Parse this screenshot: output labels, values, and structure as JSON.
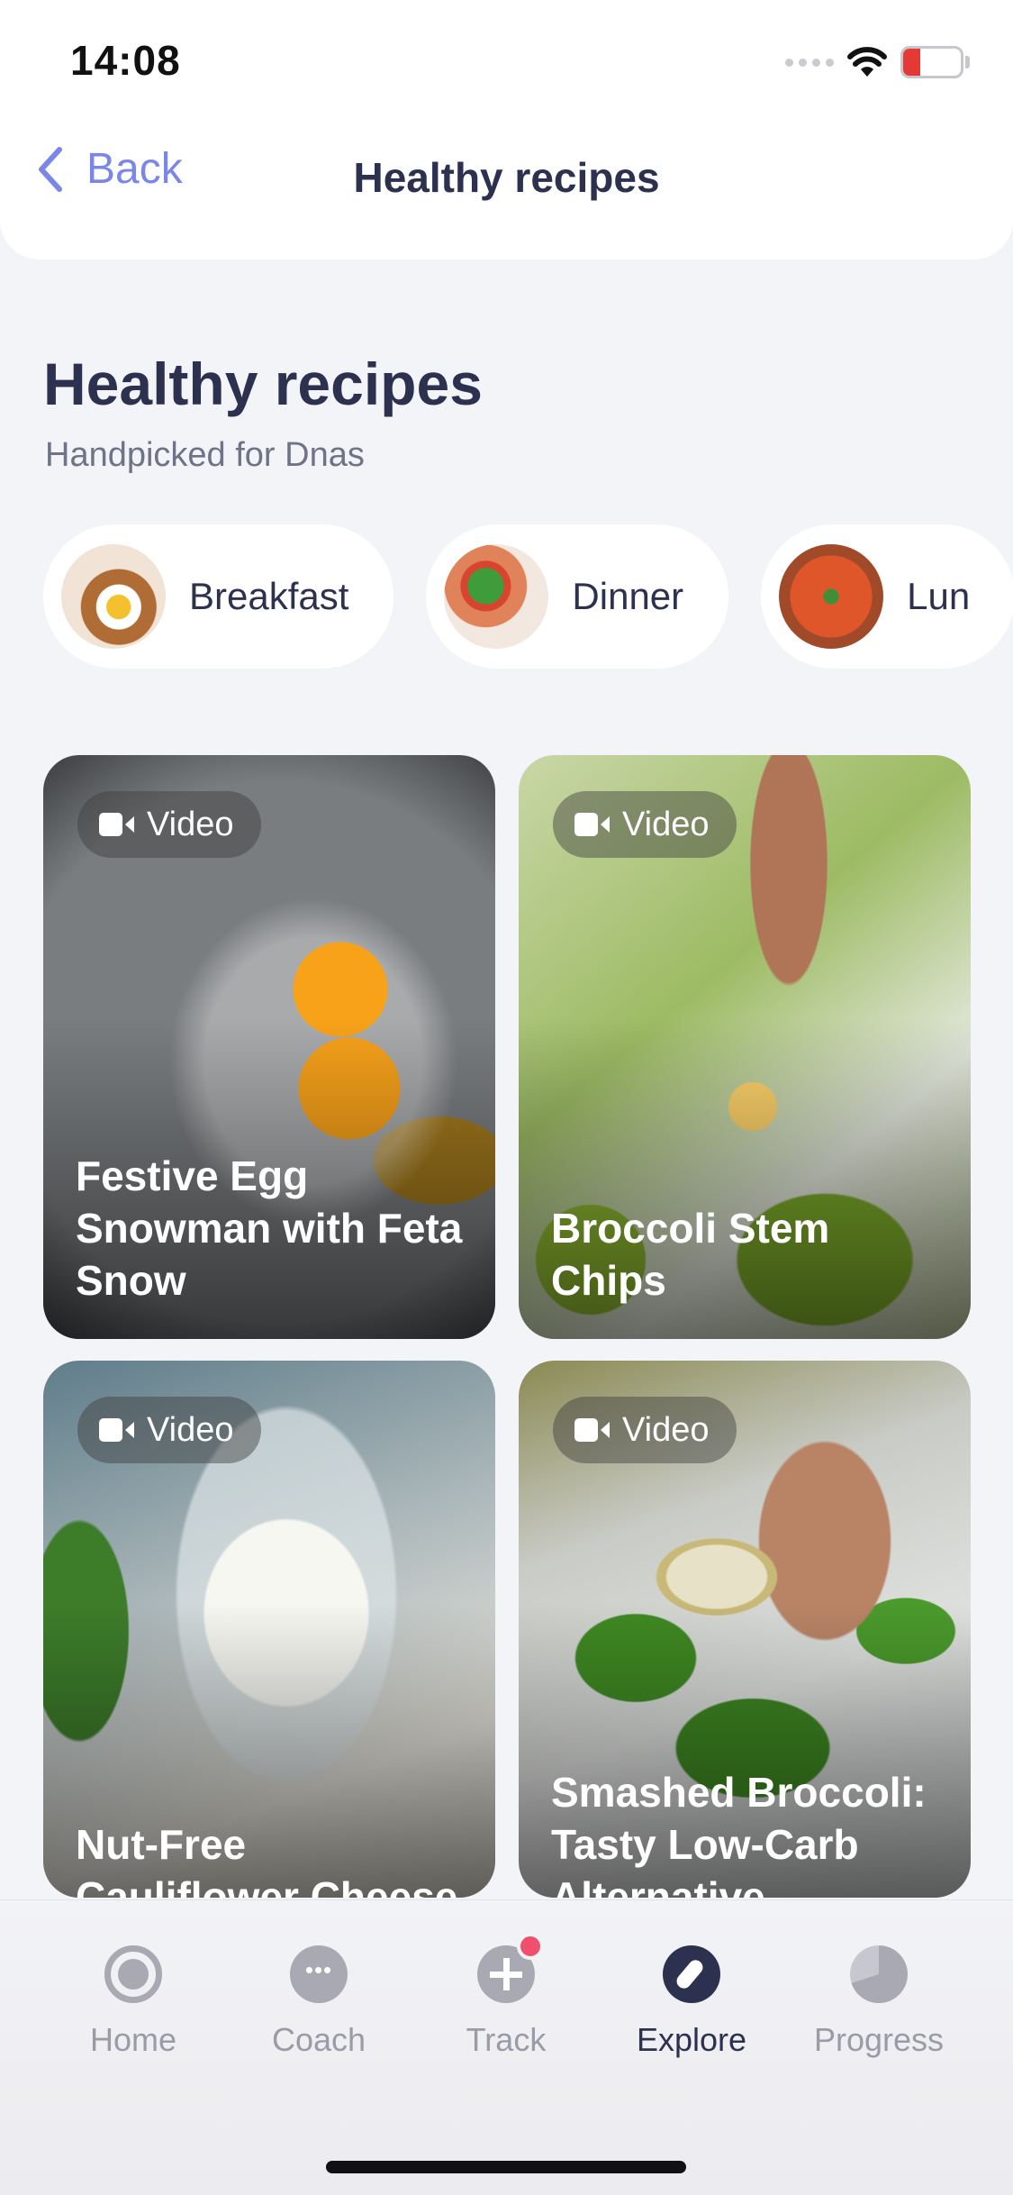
{
  "status_bar": {
    "time": "14:08",
    "battery": "13"
  },
  "nav": {
    "back_label": "Back",
    "title": "Healthy recipes"
  },
  "header": {
    "title": "Healthy recipes",
    "subtitle": "Handpicked for Dnas"
  },
  "categories": [
    {
      "label": "Breakfast"
    },
    {
      "label": "Dinner"
    },
    {
      "label": "Lun"
    }
  ],
  "recipes": [
    {
      "badge": "Video",
      "title": "Festive Egg Snowman with Feta Snow"
    },
    {
      "badge": "Video",
      "title": "Broccoli Stem Chips"
    },
    {
      "badge": "Video",
      "title": "Nut-Free Cauliflower Cheese"
    },
    {
      "badge": "Video",
      "title": "Smashed Broccoli: Tasty Low-Carb Alternative"
    }
  ],
  "tabbar": {
    "items": [
      {
        "label": "Home",
        "icon": "home-icon"
      },
      {
        "label": "Coach",
        "icon": "chat-icon"
      },
      {
        "label": "Track",
        "icon": "plus-icon"
      },
      {
        "label": "Explore",
        "icon": "compass-icon",
        "active": true
      },
      {
        "label": "Progress",
        "icon": "pie-chart-icon"
      }
    ]
  },
  "colors": {
    "accent": "#7a86e8",
    "text_dark": "#2d3150",
    "notification": "#f0506e"
  }
}
